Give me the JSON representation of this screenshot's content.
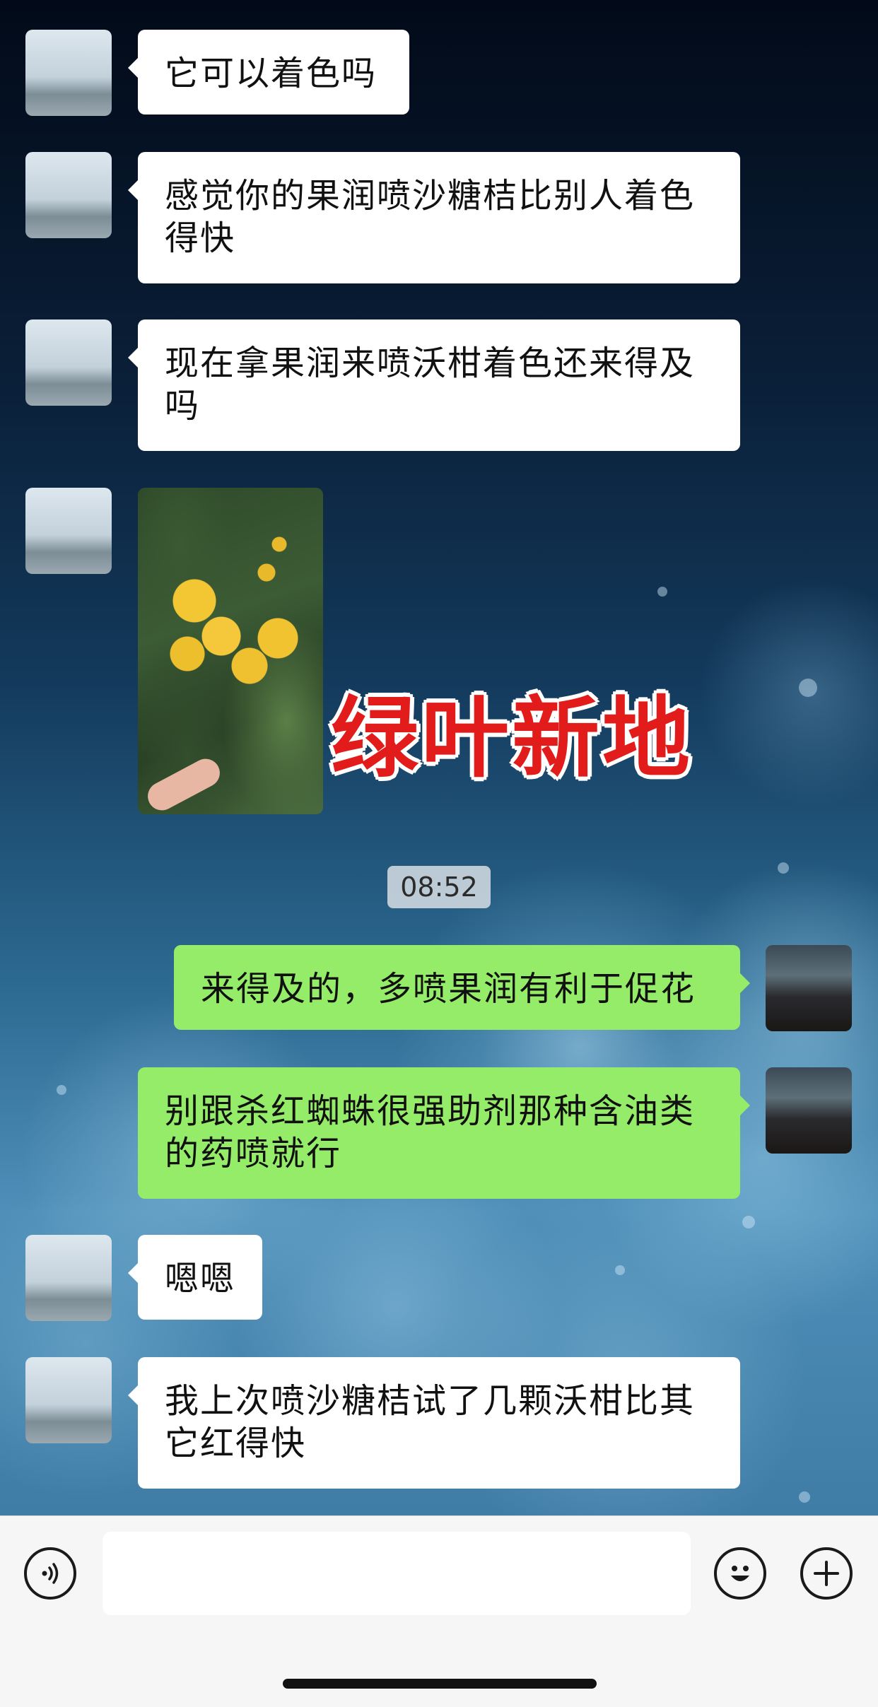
{
  "chat": {
    "messages": [
      {
        "id": "m1",
        "side": "left",
        "kind": "text",
        "text": "它可以着色吗"
      },
      {
        "id": "m2",
        "side": "left",
        "kind": "text",
        "lines": [
          "感觉你的果润喷沙糖桔比别人着色",
          "得快"
        ]
      },
      {
        "id": "m3",
        "side": "left",
        "kind": "text",
        "lines": [
          "现在拿果润来喷沃柑着色还来得及",
          "吗"
        ]
      },
      {
        "id": "m4",
        "side": "left",
        "kind": "image",
        "alt": "citrus fruit on tree photo"
      },
      {
        "id": "m5",
        "side": "right",
        "kind": "text",
        "text": "来得及的，多喷果润有利于促花"
      },
      {
        "id": "m6",
        "side": "right",
        "kind": "text",
        "lines": [
          "别跟杀红蜘蛛很强助剂那种含油类",
          "的药喷就行"
        ]
      },
      {
        "id": "m7",
        "side": "left",
        "kind": "text",
        "text": "嗯嗯"
      },
      {
        "id": "m8",
        "side": "left",
        "kind": "text",
        "lines": [
          "我上次喷沙糖桔试了几颗沃柑比其",
          "它红得快"
        ]
      }
    ],
    "timestamp": "08:52",
    "watermark": "绿叶新地"
  },
  "input_bar": {
    "voice_icon": "voice-icon",
    "emoji_icon": "emoji-icon",
    "plus_icon": "plus-icon",
    "input_value": ""
  },
  "colors": {
    "incoming_bubble": "#ffffff",
    "outgoing_bubble": "#95ec69",
    "watermark": "#e21b1b"
  }
}
